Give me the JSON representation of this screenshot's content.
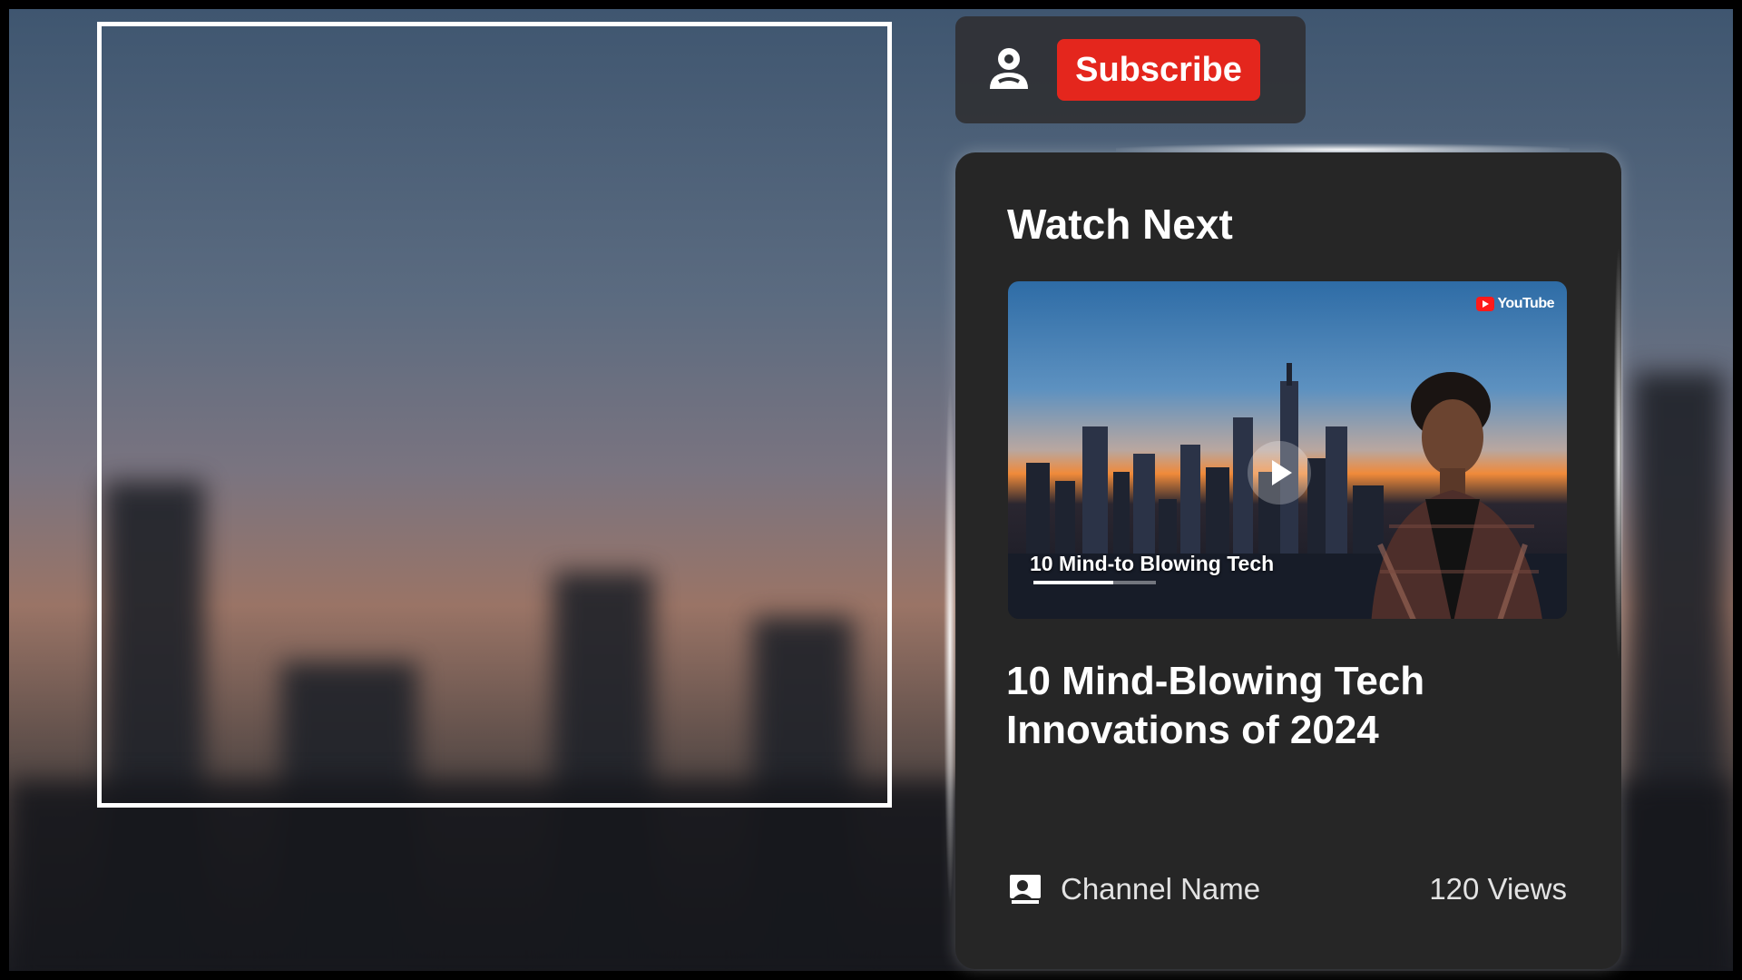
{
  "subscribe": {
    "button_label": "Subscribe",
    "icon": "user-icon"
  },
  "watch_next": {
    "heading": "Watch Next",
    "thumbnail": {
      "brand": "YouTube",
      "caption": "10 Mind-to Blowing Tech",
      "progress": 0.65,
      "play_icon": "play-icon"
    },
    "video_title": "10 Mind-Blowing Tech Innovations of 2024",
    "channel_name": "Channel Name",
    "channel_icon": "channel-icon",
    "views": "120 Views"
  },
  "colors": {
    "subscribe_red": "#e4261d",
    "card_bg": "#262626",
    "panel_bg": "#303236"
  }
}
